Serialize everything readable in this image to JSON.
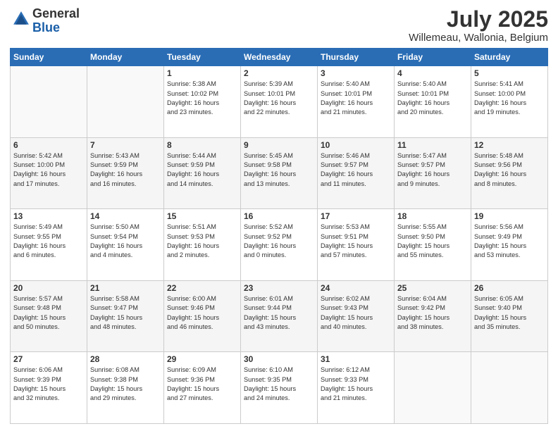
{
  "logo": {
    "general": "General",
    "blue": "Blue"
  },
  "header": {
    "month": "July 2025",
    "location": "Willemeau, Wallonia, Belgium"
  },
  "weekdays": [
    "Sunday",
    "Monday",
    "Tuesday",
    "Wednesday",
    "Thursday",
    "Friday",
    "Saturday"
  ],
  "weeks": [
    [
      {
        "day": "",
        "info": ""
      },
      {
        "day": "",
        "info": ""
      },
      {
        "day": "1",
        "info": "Sunrise: 5:38 AM\nSunset: 10:02 PM\nDaylight: 16 hours\nand 23 minutes."
      },
      {
        "day": "2",
        "info": "Sunrise: 5:39 AM\nSunset: 10:01 PM\nDaylight: 16 hours\nand 22 minutes."
      },
      {
        "day": "3",
        "info": "Sunrise: 5:40 AM\nSunset: 10:01 PM\nDaylight: 16 hours\nand 21 minutes."
      },
      {
        "day": "4",
        "info": "Sunrise: 5:40 AM\nSunset: 10:01 PM\nDaylight: 16 hours\nand 20 minutes."
      },
      {
        "day": "5",
        "info": "Sunrise: 5:41 AM\nSunset: 10:00 PM\nDaylight: 16 hours\nand 19 minutes."
      }
    ],
    [
      {
        "day": "6",
        "info": "Sunrise: 5:42 AM\nSunset: 10:00 PM\nDaylight: 16 hours\nand 17 minutes."
      },
      {
        "day": "7",
        "info": "Sunrise: 5:43 AM\nSunset: 9:59 PM\nDaylight: 16 hours\nand 16 minutes."
      },
      {
        "day": "8",
        "info": "Sunrise: 5:44 AM\nSunset: 9:59 PM\nDaylight: 16 hours\nand 14 minutes."
      },
      {
        "day": "9",
        "info": "Sunrise: 5:45 AM\nSunset: 9:58 PM\nDaylight: 16 hours\nand 13 minutes."
      },
      {
        "day": "10",
        "info": "Sunrise: 5:46 AM\nSunset: 9:57 PM\nDaylight: 16 hours\nand 11 minutes."
      },
      {
        "day": "11",
        "info": "Sunrise: 5:47 AM\nSunset: 9:57 PM\nDaylight: 16 hours\nand 9 minutes."
      },
      {
        "day": "12",
        "info": "Sunrise: 5:48 AM\nSunset: 9:56 PM\nDaylight: 16 hours\nand 8 minutes."
      }
    ],
    [
      {
        "day": "13",
        "info": "Sunrise: 5:49 AM\nSunset: 9:55 PM\nDaylight: 16 hours\nand 6 minutes."
      },
      {
        "day": "14",
        "info": "Sunrise: 5:50 AM\nSunset: 9:54 PM\nDaylight: 16 hours\nand 4 minutes."
      },
      {
        "day": "15",
        "info": "Sunrise: 5:51 AM\nSunset: 9:53 PM\nDaylight: 16 hours\nand 2 minutes."
      },
      {
        "day": "16",
        "info": "Sunrise: 5:52 AM\nSunset: 9:52 PM\nDaylight: 16 hours\nand 0 minutes."
      },
      {
        "day": "17",
        "info": "Sunrise: 5:53 AM\nSunset: 9:51 PM\nDaylight: 15 hours\nand 57 minutes."
      },
      {
        "day": "18",
        "info": "Sunrise: 5:55 AM\nSunset: 9:50 PM\nDaylight: 15 hours\nand 55 minutes."
      },
      {
        "day": "19",
        "info": "Sunrise: 5:56 AM\nSunset: 9:49 PM\nDaylight: 15 hours\nand 53 minutes."
      }
    ],
    [
      {
        "day": "20",
        "info": "Sunrise: 5:57 AM\nSunset: 9:48 PM\nDaylight: 15 hours\nand 50 minutes."
      },
      {
        "day": "21",
        "info": "Sunrise: 5:58 AM\nSunset: 9:47 PM\nDaylight: 15 hours\nand 48 minutes."
      },
      {
        "day": "22",
        "info": "Sunrise: 6:00 AM\nSunset: 9:46 PM\nDaylight: 15 hours\nand 46 minutes."
      },
      {
        "day": "23",
        "info": "Sunrise: 6:01 AM\nSunset: 9:44 PM\nDaylight: 15 hours\nand 43 minutes."
      },
      {
        "day": "24",
        "info": "Sunrise: 6:02 AM\nSunset: 9:43 PM\nDaylight: 15 hours\nand 40 minutes."
      },
      {
        "day": "25",
        "info": "Sunrise: 6:04 AM\nSunset: 9:42 PM\nDaylight: 15 hours\nand 38 minutes."
      },
      {
        "day": "26",
        "info": "Sunrise: 6:05 AM\nSunset: 9:40 PM\nDaylight: 15 hours\nand 35 minutes."
      }
    ],
    [
      {
        "day": "27",
        "info": "Sunrise: 6:06 AM\nSunset: 9:39 PM\nDaylight: 15 hours\nand 32 minutes."
      },
      {
        "day": "28",
        "info": "Sunrise: 6:08 AM\nSunset: 9:38 PM\nDaylight: 15 hours\nand 29 minutes."
      },
      {
        "day": "29",
        "info": "Sunrise: 6:09 AM\nSunset: 9:36 PM\nDaylight: 15 hours\nand 27 minutes."
      },
      {
        "day": "30",
        "info": "Sunrise: 6:10 AM\nSunset: 9:35 PM\nDaylight: 15 hours\nand 24 minutes."
      },
      {
        "day": "31",
        "info": "Sunrise: 6:12 AM\nSunset: 9:33 PM\nDaylight: 15 hours\nand 21 minutes."
      },
      {
        "day": "",
        "info": ""
      },
      {
        "day": "",
        "info": ""
      }
    ]
  ]
}
